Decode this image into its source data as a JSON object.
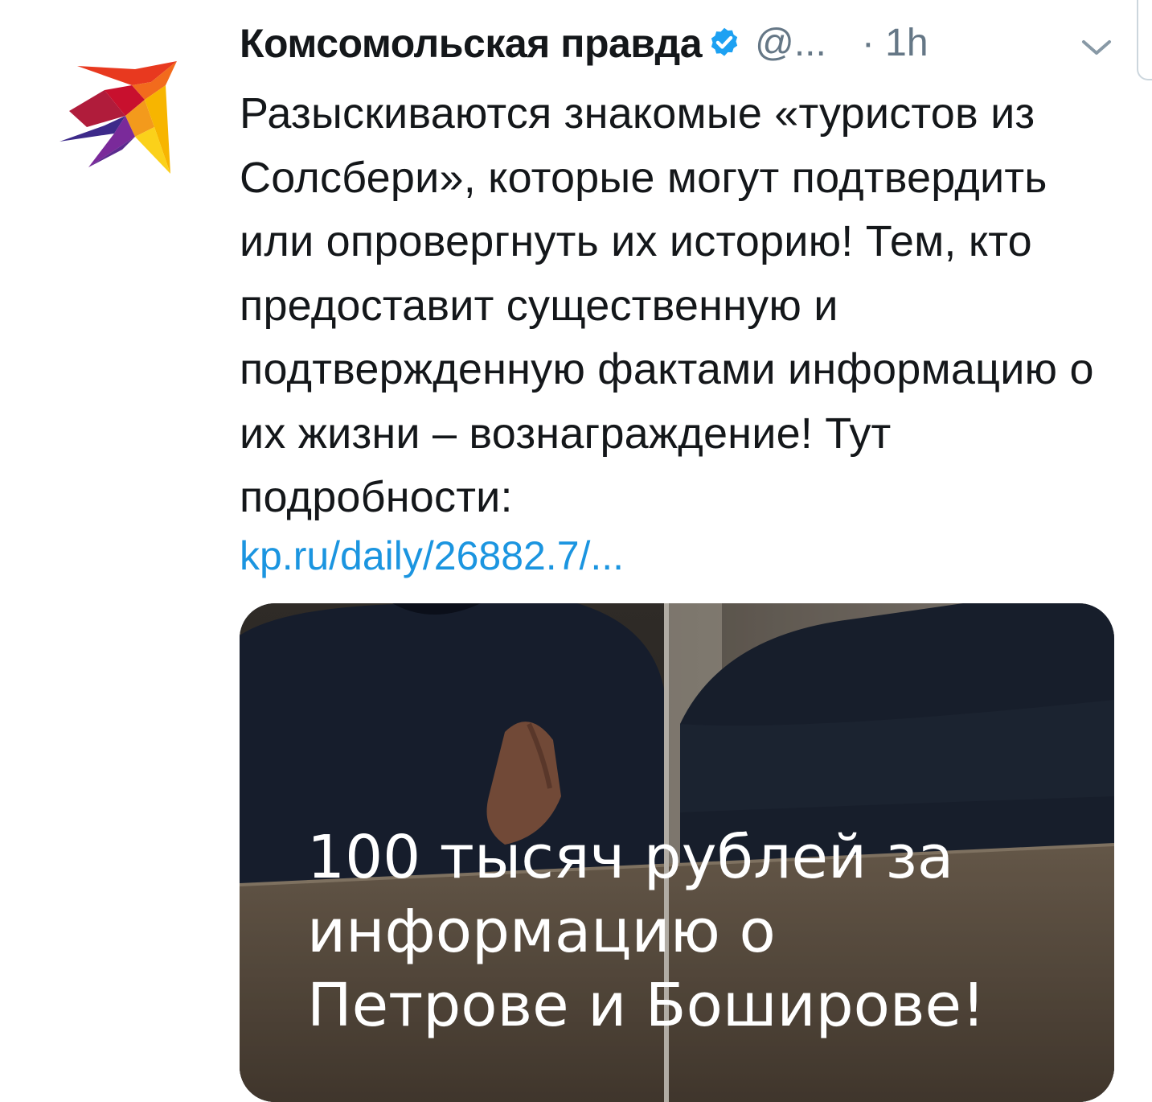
{
  "tweet": {
    "display_name": "Комсомольская правда",
    "handle": "@...",
    "time": "· 1h",
    "text": "Разыскиваются знакомые «туристов из Солсбери», которые могут подтвердить или опровергнуть их историю! Тем, кто предоставит существенную и подтвержденную фактами информацию о их жизни – вознаграждение! Тут подробности:",
    "link": "kp.ru/daily/26882.7/...",
    "verified": true
  },
  "media": {
    "caption_line1": "100 тысяч рублей за",
    "caption_line2": "информацию о",
    "caption_line3": "Петрове и Боширове!"
  },
  "colors": {
    "text": "#14171a",
    "secondary": "#657786",
    "link": "#1b95e0",
    "verified": "#1da1f2"
  },
  "icons": {
    "avatar": "kp-swallow-logo",
    "verified": "verified-badge-icon",
    "caret": "chevron-down-icon"
  }
}
